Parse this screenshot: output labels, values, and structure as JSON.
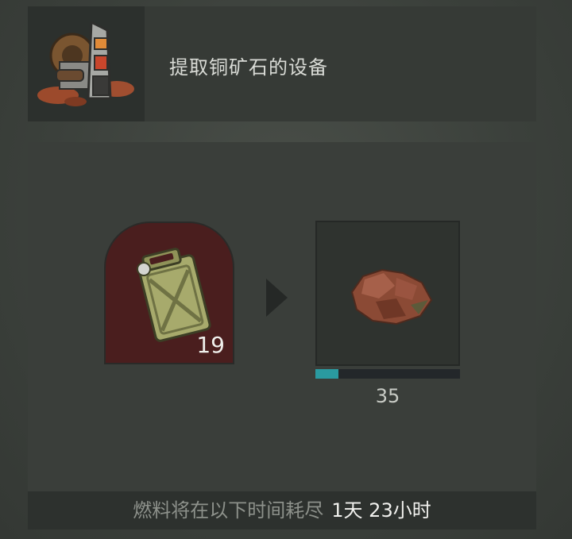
{
  "header": {
    "title": "提取铜矿石的设备",
    "icon": "mining-machine-icon"
  },
  "fuel_slot": {
    "icon": "fuel-jerrycan-icon",
    "count": "19"
  },
  "output_slot": {
    "icon": "copper-ore-icon",
    "count": "35",
    "progress": 0.16
  },
  "status": {
    "label": "燃料将在以下时间耗尽",
    "value": "1天 23小时"
  },
  "colors": {
    "fuel_slot_bg": "#4a1e1e",
    "progress_fill": "#2a9aa0",
    "panel_bg": "#3a3e3a"
  }
}
